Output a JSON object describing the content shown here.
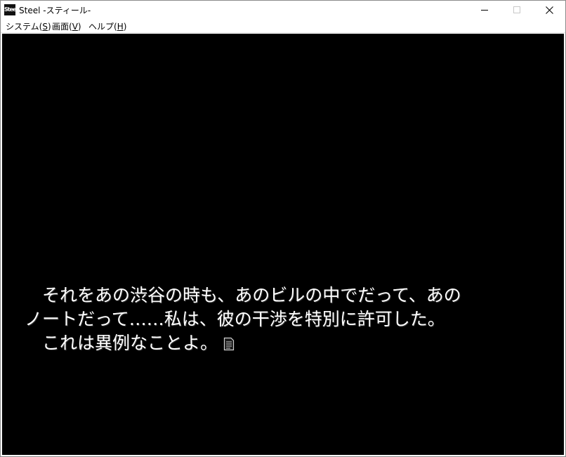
{
  "window": {
    "title": "Steel -スティール-",
    "icon_label": "Steel",
    "controls": {
      "minimize": "minimize-icon",
      "maximize": "maximize-icon",
      "close": "close-icon"
    }
  },
  "menubar": {
    "items": [
      {
        "label": "システム(",
        "key": "S",
        "suffix": ")"
      },
      {
        "label": "画面(",
        "key": "V",
        "suffix": ")"
      },
      {
        "label": "ヘルプ(",
        "key": "H",
        "suffix": ")"
      }
    ]
  },
  "game": {
    "background": "#000000",
    "text_color": "#ffffff",
    "dialogue": {
      "lines": [
        "　それをあの渋谷の時も、あのビルの中でだって、あの",
        "ノートだって……私は、彼の干渉を特別に許可した。",
        "　これは異例なことよ。"
      ],
      "wait_icon": "page-wait-icon"
    }
  }
}
